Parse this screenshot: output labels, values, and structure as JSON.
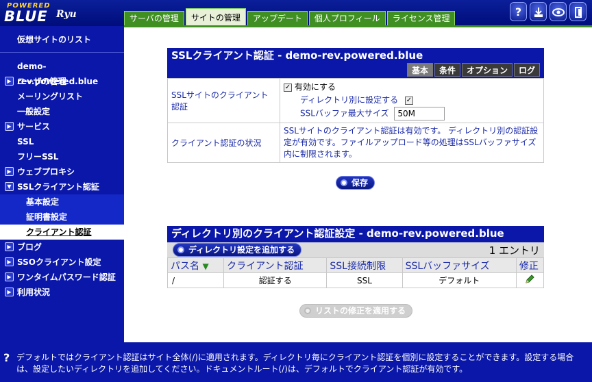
{
  "logo": {
    "top": "POWERED",
    "main": "BLUE",
    "sub": "Ryu"
  },
  "tabs": [
    "サーバの管理",
    "サイトの管理",
    "アップデート",
    "個人プロフィール",
    "ライセンス管理"
  ],
  "sidebar": {
    "items": [
      {
        "label": "仮想サイトのリスト"
      },
      {
        "label": "demo-rev.powered.blue"
      },
      {
        "label": "ユーザの管理"
      },
      {
        "label": "メーリングリスト"
      },
      {
        "label": "一般設定"
      },
      {
        "label": "サービス"
      },
      {
        "label": "SSL"
      },
      {
        "label": "フリーSSL"
      },
      {
        "label": "ウェブプロキシ"
      },
      {
        "label": "SSLクライアント認証"
      },
      {
        "label": "基本設定"
      },
      {
        "label": "証明書設定"
      },
      {
        "label": "クライアント認証"
      },
      {
        "label": "ブログ"
      },
      {
        "label": "SSOクライアント設定"
      },
      {
        "label": "ワンタイムパスワード認証"
      },
      {
        "label": "利用状況"
      }
    ]
  },
  "panel1": {
    "title": "SSLクライアント認証 - demo-rev.powered.blue",
    "subtabs": [
      "基本",
      "条件",
      "オプション",
      "ログ"
    ],
    "row1_label": "SSLサイトのクライアント認証",
    "enable_label": "有効にする",
    "perdir_label": "ディレクトリ別に設定する",
    "buffer_label": "SSLバッファ最大サイズ",
    "buffer_value": "50M",
    "row2_label": "クライアント認証の状況",
    "row2_text": "SSLサイトのクライアント認証は有効です。 ディレクトリ別の認証設定が有効です。ファイルアップロード等の処理はSSLバッファサイズ内に制限されます。",
    "save": "保存"
  },
  "panel2": {
    "title": "ディレクトリ別のクライアント認証設定 - demo-rev.powered.blue",
    "add_button": "ディレクトリ設定を追加する",
    "entry_count": "1 エントリ",
    "columns": [
      "パス名",
      "クライアント認証",
      "SSL接続制限",
      "SSLバッファサイズ",
      "修正"
    ],
    "rows": [
      [
        "/",
        "認証する",
        "SSL",
        "デフォルト"
      ]
    ],
    "apply_button": "リストの修正を適用する"
  },
  "footer": {
    "text": "デフォルトではクライアント認証はサイト全体(/)に適用されます。ディレクトリ毎にクライアント認証を個別に設定することができます。設定する場合は、設定したいディレクトリを追加してください。ドキュメントルート(/)は、デフォルトでクライアント認証が有効です。"
  },
  "icons": {
    "help": "help-icon",
    "download": "download-icon",
    "eye": "view-icon",
    "logout": "logout-icon"
  }
}
